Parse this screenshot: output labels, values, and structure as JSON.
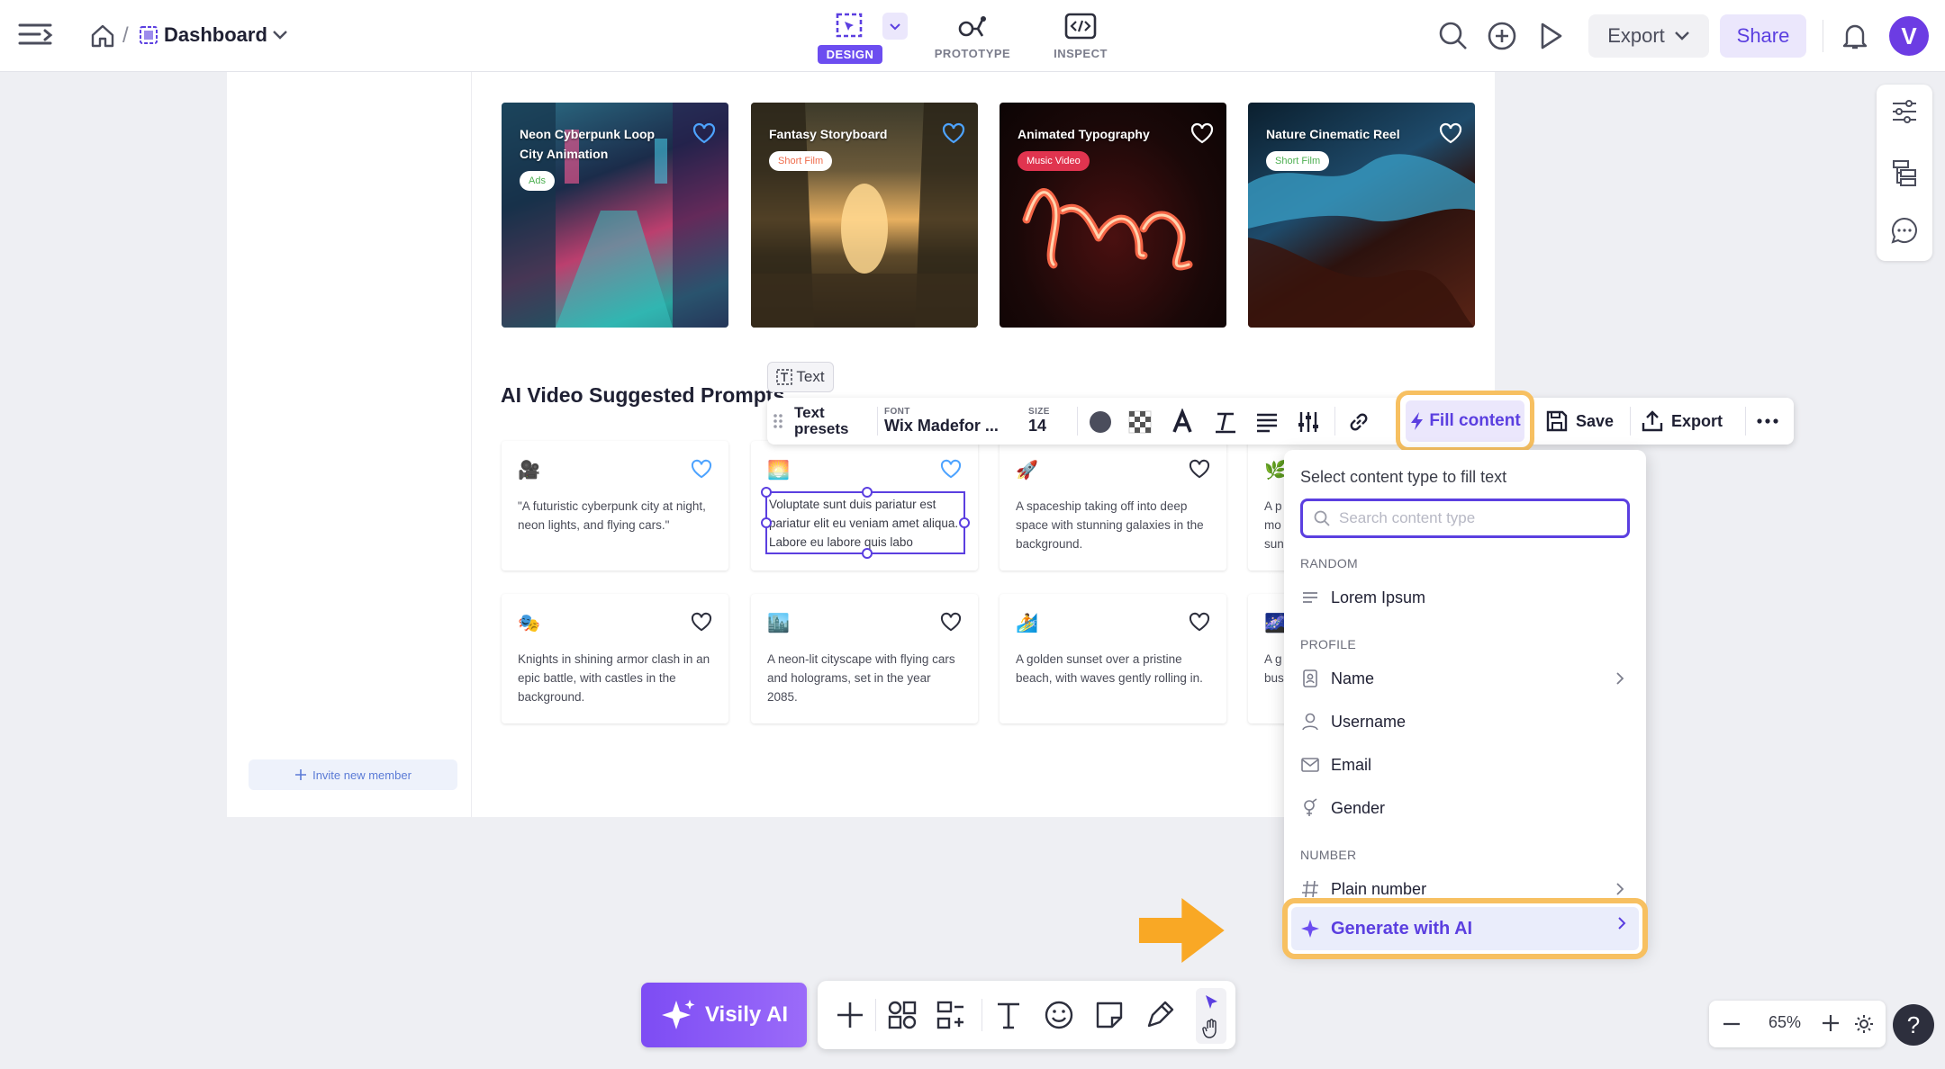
{
  "header": {
    "breadcrumb_title": "Dashboard",
    "breadcrumb_separator": "/",
    "modes": [
      {
        "label": "DESIGN",
        "active": true
      },
      {
        "label": "PROTOTYPE",
        "active": false
      },
      {
        "label": "INSPECT",
        "active": false
      }
    ],
    "export_label": "Export",
    "share_label": "Share",
    "avatar_letter": "V"
  },
  "canvas": {
    "video_cards": [
      {
        "title": "Neon Cyberpunk Loop City Animation",
        "tag": "Ads",
        "tag_color": "#4caf50",
        "heart_color": "#4da3ff"
      },
      {
        "title": "Fantasy Storyboard",
        "tag": "Short Film",
        "tag_color": "#ef6b4a",
        "heart_color": "#4da3ff"
      },
      {
        "title": "Animated Typography",
        "tag": "Music Video",
        "tag_color": "#ffffff",
        "heart_color": "#ffffff"
      },
      {
        "title": "Nature Cinematic Reel",
        "tag": "Short Film",
        "tag_color": "#4caf50",
        "heart_color": "#ffffff"
      }
    ],
    "section_title": "AI Video Suggested Prompts",
    "prompt_cards_row1": [
      {
        "emoji": "🎥",
        "text": "\"A futuristic cyberpunk city at night, neon lights, and flying cars.\"",
        "heart_color": "#4da3ff"
      },
      {
        "emoji": "🌅",
        "text": "",
        "heart_color": "#4da3ff"
      },
      {
        "emoji": "🚀",
        "text": "A spaceship taking off into deep space with stunning galaxies in the background.",
        "heart_color": "#2d2f3d"
      },
      {
        "emoji": "🌿",
        "text": "A p mo sun",
        "heart_color": "#2d2f3d"
      }
    ],
    "prompt_cards_row2": [
      {
        "emoji": "🎭",
        "text": "Knights in shining armor clash in an epic battle, with castles in the background.",
        "heart_color": "#2d2f3d"
      },
      {
        "emoji": "🏙️",
        "text": "A neon-lit cityscape with flying cars and holograms, set in the year 2085.",
        "heart_color": "#2d2f3d"
      },
      {
        "emoji": "🏄",
        "text": "A golden sunset over a pristine beach, with waves gently rolling in.",
        "heart_color": "#2d2f3d"
      },
      {
        "emoji": "🌌",
        "text": "A g bus",
        "heart_color": "#2d2f3d"
      }
    ],
    "selected_text": "Voluptate sunt duis pariatur est pariatur elit eu veniam amet aliqua. Labore eu labore quis labo",
    "invite_label": "Invite new member",
    "text_chip_label": "Text"
  },
  "text_toolbar": {
    "presets_label": "Text presets",
    "font_caption": "FONT",
    "font_value": "Wix Madefor ...",
    "size_caption": "SIZE",
    "size_value": "14",
    "fill_content_label": "Fill content",
    "save_label": "Save",
    "export_label": "Export"
  },
  "fill_dropdown": {
    "heading": "Select content type to fill text",
    "search_placeholder": "Search content type",
    "sections": {
      "random": "RANDOM",
      "profile": "PROFILE",
      "number": "NUMBER"
    },
    "items": {
      "lorem": "Lorem Ipsum",
      "name": "Name",
      "username": "Username",
      "email": "Email",
      "gender": "Gender",
      "plain_number": "Plain number",
      "generate_ai": "Generate with AI"
    }
  },
  "bottom_bar": {
    "visily_ai_label": "Visily AI",
    "zoom_value": "65%"
  },
  "colors": {
    "accent": "#5b3fe0",
    "highlight": "#f7c061",
    "brand": "#6c4df0"
  }
}
